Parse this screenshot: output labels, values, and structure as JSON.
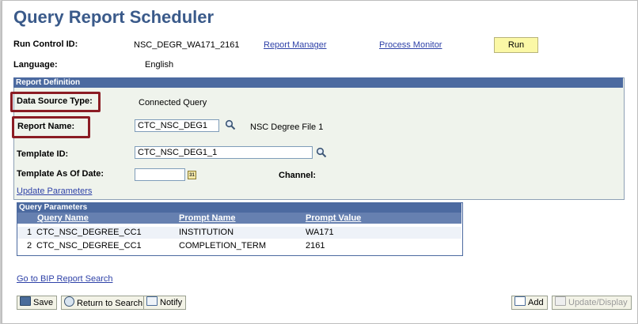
{
  "page": {
    "title": "Query Report Scheduler",
    "run_control_label": "Run Control ID:",
    "run_control_value": "NSC_DEGR_WA171_2161",
    "report_manager_link": "Report Manager",
    "process_monitor_link": "Process Monitor",
    "run_button": "Run",
    "language_label": "Language:",
    "language_value": "English"
  },
  "report_definition": {
    "header": "Report Definition",
    "data_source_label": "Data Source Type:",
    "data_source_value": "Connected Query",
    "report_name_label": "Report Name:",
    "report_name_value": "CTC_NSC_DEG1",
    "report_description": "NSC Degree File 1",
    "template_id_label": "Template ID:",
    "template_id_value": "CTC_NSC_DEG1_1",
    "template_date_label": "Template As Of Date:",
    "template_date_value": "",
    "calendar_icon_text": "31",
    "channel_label": "Channel:",
    "update_parameters_link": "Update Parameters"
  },
  "query_parameters": {
    "header": "Query Parameters",
    "columns": [
      "Query Name",
      "Prompt Name",
      "Prompt Value"
    ],
    "rows": [
      {
        "num": "1",
        "query_name": "CTC_NSC_DEGREE_CC1",
        "prompt_name": "INSTITUTION",
        "prompt_value": "WA171"
      },
      {
        "num": "2",
        "query_name": "CTC_NSC_DEGREE_CC1",
        "prompt_name": "COMPLETION_TERM",
        "prompt_value": "2161"
      }
    ]
  },
  "footer": {
    "bip_link": "Go to BIP Report Search",
    "save_button": "Save",
    "return_button": "Return to Search",
    "notify_button": "Notify",
    "add_button": "Add",
    "update_display_button": "Update/Display"
  },
  "colors": {
    "title": "#3a5a8a",
    "section_header": "#4c6aa0",
    "section_background": "#eff3ec",
    "highlight_box": "#8b1c24",
    "run_button": "#fbf8a6"
  }
}
